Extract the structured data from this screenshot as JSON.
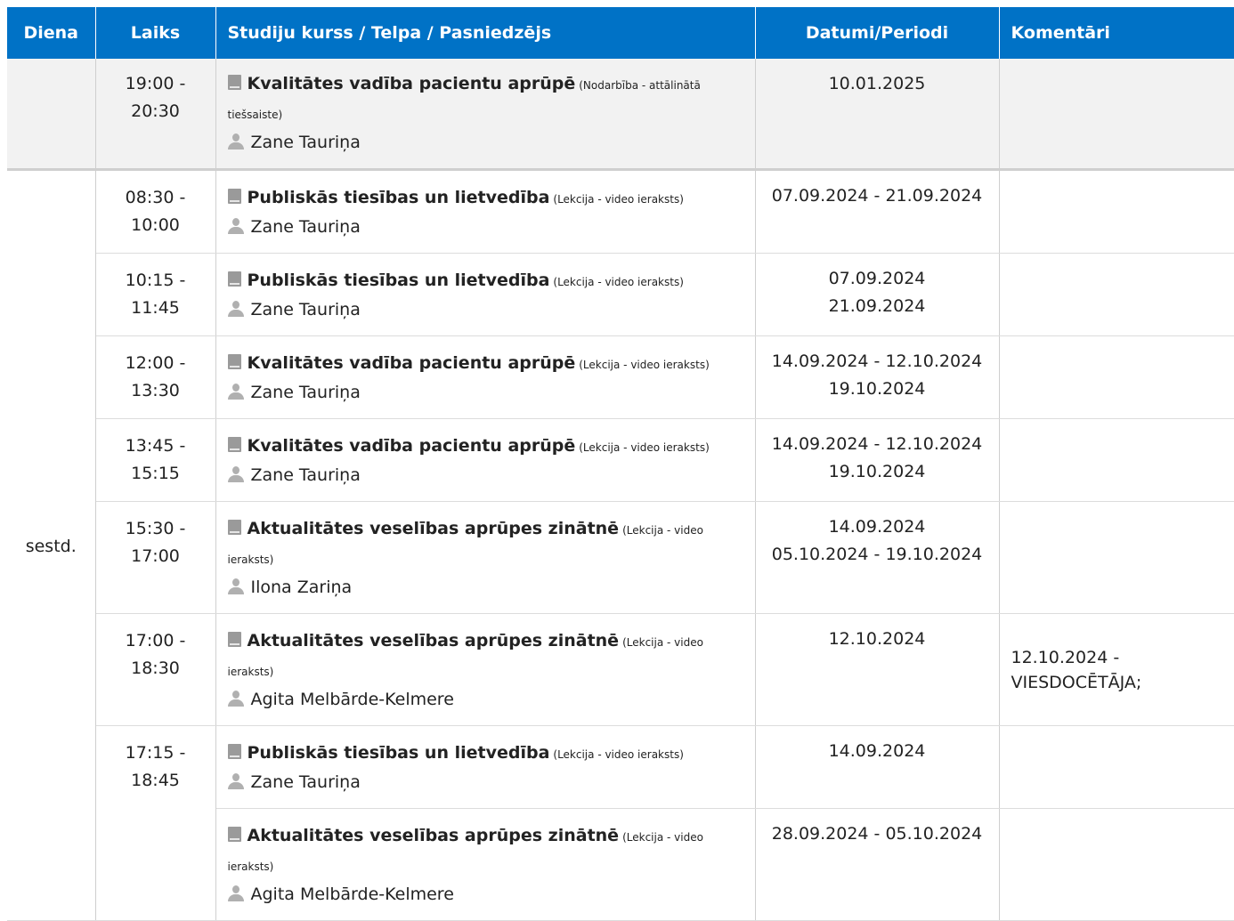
{
  "headers": {
    "day": "Diena",
    "time": "Laiks",
    "course": "Studiju kurss / Telpa / Pasniedzējs",
    "dates": "Datumi/Periodi",
    "comments": "Komentāri"
  },
  "previous_row": {
    "day": "",
    "time": "19:00 - 20:30",
    "course": "Kvalitātes vadība pacientu aprūpē",
    "type": "(Nodarbība - attālinātā tiešsaiste)",
    "teacher": "Zane Tauriņa",
    "dates": [
      "10.01.2025"
    ],
    "comment": ""
  },
  "group": {
    "day": "sestd.",
    "rows": [
      {
        "time": "08:30 - 10:00",
        "course": "Publiskās tiesības un lietvedība",
        "type": "(Lekcija - video ieraksts)",
        "teacher": "Zane Tauriņa",
        "dates": [
          "07.09.2024 - 21.09.2024"
        ],
        "comment": ""
      },
      {
        "time": "10:15 - 11:45",
        "course": "Publiskās tiesības un lietvedība",
        "type": "(Lekcija - video ieraksts)",
        "teacher": "Zane Tauriņa",
        "dates": [
          "07.09.2024",
          "21.09.2024"
        ],
        "comment": ""
      },
      {
        "time": "12:00 - 13:30",
        "course": "Kvalitātes vadība pacientu aprūpē",
        "type": "(Lekcija - video ieraksts)",
        "teacher": "Zane Tauriņa",
        "dates": [
          "14.09.2024 - 12.10.2024",
          "19.10.2024"
        ],
        "comment": ""
      },
      {
        "time": "13:45 - 15:15",
        "course": "Kvalitātes vadība pacientu aprūpē",
        "type": "(Lekcija - video ieraksts)",
        "teacher": "Zane Tauriņa",
        "dates": [
          "14.09.2024 - 12.10.2024",
          "19.10.2024"
        ],
        "comment": ""
      },
      {
        "time": "15:30 - 17:00",
        "course": "Aktualitātes veselības aprūpes zinātnē",
        "type": "(Lekcija - video ieraksts)",
        "teacher": "Ilona Zariņa",
        "dates": [
          "14.09.2024",
          "05.10.2024 - 19.10.2024"
        ],
        "comment": ""
      },
      {
        "time": "17:00 - 18:30",
        "course": "Aktualitātes veselības aprūpes zinātnē",
        "type": "(Lekcija - video ieraksts)",
        "teacher": "Agita Melbārde-Kelmere",
        "dates": [
          "12.10.2024"
        ],
        "comment": "12.10.2024 - VIESDOCĒTĀJA;"
      },
      {
        "time": "17:15 - 18:45",
        "course": "Publiskās tiesības un lietvedība",
        "type": "(Lekcija - video ieraksts)",
        "teacher": "Zane Tauriņa",
        "dates": [
          "14.09.2024"
        ],
        "comment": ""
      },
      {
        "time": "",
        "course": "Aktualitātes veselības aprūpes zinātnē",
        "type": "(Lekcija - video ieraksts)",
        "teacher": "Agita Melbārde-Kelmere",
        "dates": [
          "28.09.2024 - 05.10.2024"
        ],
        "comment": ""
      }
    ]
  }
}
